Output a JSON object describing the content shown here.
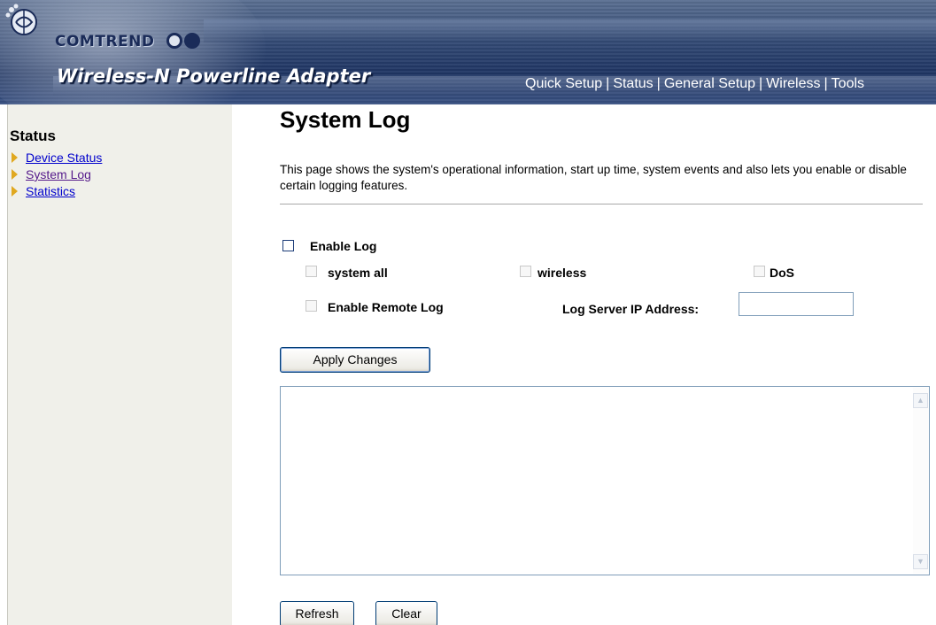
{
  "header": {
    "brand": "COMTREND",
    "product": "Wireless-N Powerline Adapter",
    "nav": [
      "Quick Setup",
      "Status",
      "General Setup",
      "Wireless",
      "Tools"
    ],
    "colors": {
      "banner": "#2f4672",
      "brand_text": "#1a2b58"
    }
  },
  "sidebar": {
    "title": "Status",
    "items": [
      {
        "label": "Device Status"
      },
      {
        "label": "System Log"
      },
      {
        "label": "Statistics"
      }
    ]
  },
  "main": {
    "title": "System Log",
    "description": "This page shows the system's operational information, start up time, system events and also lets you enable or disable certain logging features.",
    "enable_log_label": "Enable Log",
    "options": {
      "system_all": "system all",
      "wireless": "wireless",
      "dos": "DoS",
      "enable_remote_log": "Enable Remote Log",
      "log_server_label": "Log Server IP Address:",
      "log_server_value": ""
    },
    "apply_label": "Apply Changes",
    "log_text": "",
    "refresh_label": "Refresh",
    "clear_label": "Clear"
  }
}
